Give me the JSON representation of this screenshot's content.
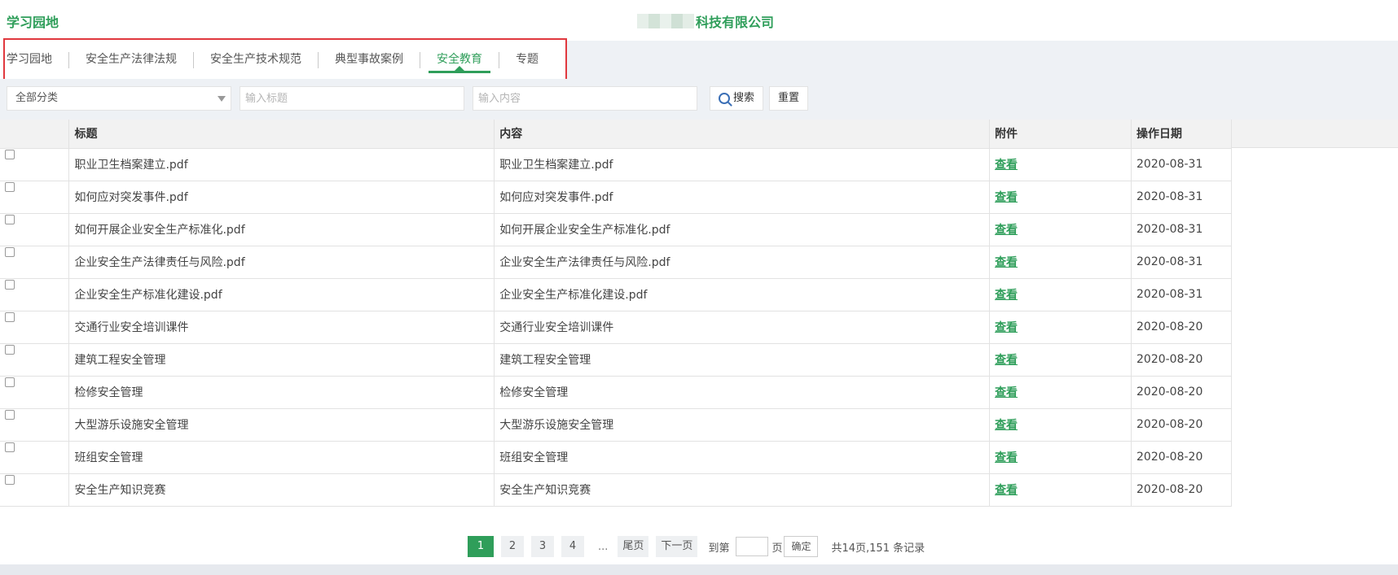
{
  "header": {
    "app_title": "学习园地",
    "company_suffix": "科技有限公司"
  },
  "tabs": [
    {
      "label": "学习园地"
    },
    {
      "label": "安全生产法律法规"
    },
    {
      "label": "安全生产技术规范"
    },
    {
      "label": "典型事故案例"
    },
    {
      "label": "安全教育",
      "active": true
    },
    {
      "label": "专题"
    }
  ],
  "filters": {
    "category_selected": "全部分类",
    "title_placeholder": "输入标题",
    "content_placeholder": "输入内容",
    "search_label": "搜索",
    "reset_label": "重置"
  },
  "table": {
    "headers": [
      "标题",
      "内容",
      "附件",
      "操作日期"
    ],
    "view_label": "查看",
    "rows": [
      {
        "title": "职业卫生档案建立.pdf",
        "content": "职业卫生档案建立.pdf",
        "date": "2020-08-31"
      },
      {
        "title": "如何应对突发事件.pdf",
        "content": "如何应对突发事件.pdf",
        "date": "2020-08-31"
      },
      {
        "title": "如何开展企业安全生产标准化.pdf",
        "content": "如何开展企业安全生产标准化.pdf",
        "date": "2020-08-31"
      },
      {
        "title": "企业安全生产法律责任与风险.pdf",
        "content": "企业安全生产法律责任与风险.pdf",
        "date": "2020-08-31"
      },
      {
        "title": "企业安全生产标准化建设.pdf",
        "content": "企业安全生产标准化建设.pdf",
        "date": "2020-08-31"
      },
      {
        "title": "交通行业安全培训课件",
        "content": "交通行业安全培训课件",
        "date": "2020-08-20"
      },
      {
        "title": "建筑工程安全管理",
        "content": "建筑工程安全管理",
        "date": "2020-08-20"
      },
      {
        "title": "检修安全管理",
        "content": "检修安全管理",
        "date": "2020-08-20"
      },
      {
        "title": "大型游乐设施安全管理",
        "content": "大型游乐设施安全管理",
        "date": "2020-08-20"
      },
      {
        "title": "班组安全管理",
        "content": "班组安全管理",
        "date": "2020-08-20"
      },
      {
        "title": "安全生产知识竞赛",
        "content": "安全生产知识竞赛",
        "date": "2020-08-20"
      }
    ]
  },
  "pagination": {
    "pages": [
      "1",
      "2",
      "3",
      "4"
    ],
    "current": "1",
    "ellipsis": "...",
    "last_label": "尾页",
    "next_label": "下一页",
    "goto_prefix": "到第",
    "goto_suffix": "页",
    "confirm_label": "确定",
    "summary": "共14页,151 条记录"
  },
  "colors": {
    "accent": "#2f9e5a",
    "highlight_border": "#e0383e",
    "toolbar_bg": "#eef1f5"
  }
}
